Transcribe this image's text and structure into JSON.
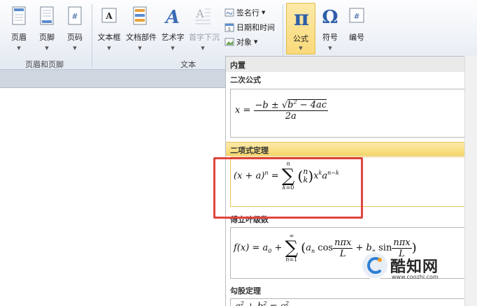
{
  "ribbon": {
    "header_btn": "页眉",
    "footer_btn": "页脚",
    "pagenum_btn": "页码",
    "group_header_footer": "页眉和页脚",
    "textbox_btn": "文本框",
    "quickparts_btn": "文档部件",
    "wordart_btn": "艺术字",
    "dropcap_btn": "首字下沉",
    "group_text": "文本",
    "signature_btn": "签名行",
    "datetime_btn": "日期和时间",
    "object_btn": "对象",
    "equation_btn": "公式",
    "symbol_btn": "符号",
    "number_btn": "编号"
  },
  "gallery": {
    "category": "内置",
    "items": [
      {
        "title": "二次公式"
      },
      {
        "title": "二项式定理"
      },
      {
        "title": "傅立叶级数"
      },
      {
        "title": "勾股定理"
      }
    ]
  },
  "watermark": {
    "text": "酷知网",
    "url": "www.coozhi.com"
  },
  "colors": {
    "highlight": "#f7d86c",
    "red_box": "#e0453f",
    "equation_active": "#f9d97a"
  }
}
